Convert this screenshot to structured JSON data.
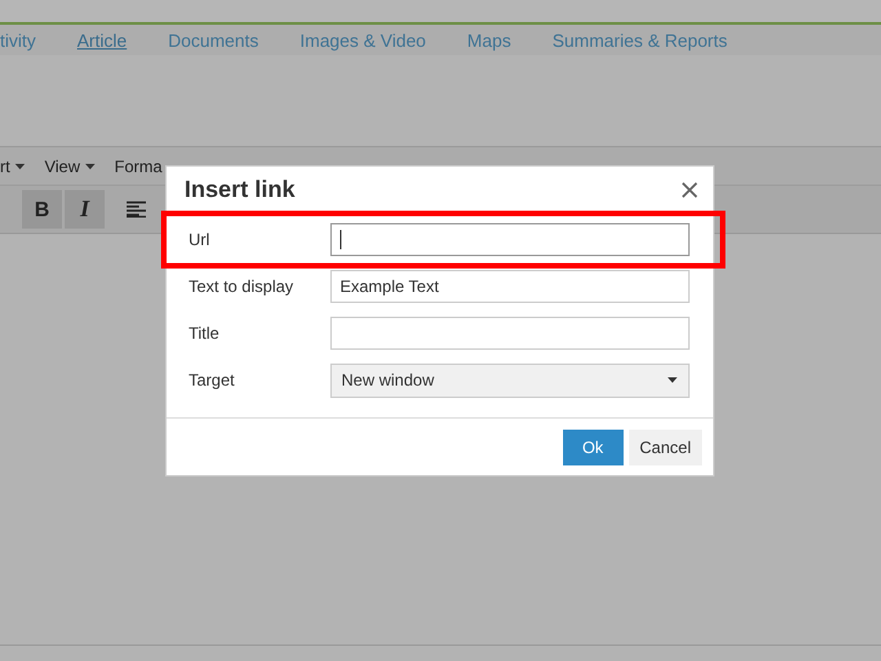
{
  "nav_tabs": [
    {
      "label": "tivity",
      "selected": false
    },
    {
      "label": "Article",
      "selected": true
    },
    {
      "label": "Documents",
      "selected": false
    },
    {
      "label": "Images & Video",
      "selected": false
    },
    {
      "label": "Maps",
      "selected": false
    },
    {
      "label": "Summaries & Reports",
      "selected": false
    }
  ],
  "editor_menu": [
    {
      "label": "rt"
    },
    {
      "label": "View"
    },
    {
      "label": "Forma"
    }
  ],
  "editor_toolbar": [
    {
      "kind": "bold",
      "label": "B",
      "pressed": true
    },
    {
      "kind": "italic",
      "label": "I",
      "pressed": true
    },
    {
      "kind": "align-left",
      "pressed": false
    }
  ],
  "dialog": {
    "title": "Insert link",
    "fields": [
      {
        "kind": "text",
        "label": "Url",
        "focused": true,
        "highlighted": true
      },
      {
        "kind": "text",
        "label": "Text to display",
        "value": "Example Text",
        "focused": false,
        "highlighted": false
      },
      {
        "kind": "text",
        "label": "Title",
        "focused": false,
        "highlighted": false
      },
      {
        "kind": "select",
        "label": "Target",
        "value": "New window",
        "focused": false,
        "highlighted": false
      }
    ],
    "buttons": [
      {
        "label": "Ok",
        "primary": true
      },
      {
        "label": "Cancel",
        "primary": false
      }
    ]
  }
}
